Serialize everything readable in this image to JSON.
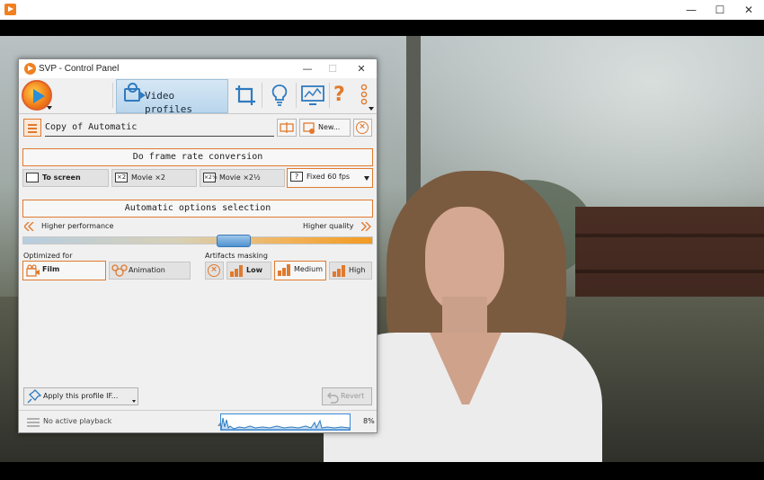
{
  "host_window": {
    "controls": {
      "minimize": "—",
      "maximize": "☐",
      "close": "✕"
    }
  },
  "panel": {
    "title": "SVP - Control Panel",
    "controls": {
      "minimize": "—",
      "maximize": "☐",
      "close": "✕"
    },
    "toolbar": {
      "active_tab": "Video profiles",
      "icons": [
        "crop-icon",
        "lightbulb-icon",
        "monitor-icon",
        "help-icon",
        "more-options-icon"
      ],
      "help_glyph": "?"
    },
    "profile": {
      "name": "Copy of Automatic",
      "new_button": "New..."
    },
    "frame_rate": {
      "header": "Do frame rate conversion",
      "options": [
        {
          "label": "To screen",
          "selected": false
        },
        {
          "label": "Movie ×2",
          "icon_text": "×2",
          "selected": false
        },
        {
          "label": "Movie ×2½",
          "icon_text": "×2½",
          "selected": false
        },
        {
          "label": "Fixed 60 fps",
          "icon_text": "?",
          "selected": true
        }
      ]
    },
    "auto_options": {
      "header": "Automatic options selection",
      "left_label": "Higher performance",
      "right_label": "Higher quality",
      "slider_position": 0.6
    },
    "optimized_for": {
      "label": "Optimized for",
      "options": [
        {
          "label": "Film",
          "selected": true
        },
        {
          "label": "Animation",
          "selected": false
        }
      ]
    },
    "artifacts_masking": {
      "label": "Artifacts masking",
      "options": [
        {
          "label": "Low",
          "selected": false
        },
        {
          "label": "Medium",
          "selected": true
        },
        {
          "label": "High",
          "selected": false
        }
      ]
    },
    "footer": {
      "apply_button": "Apply this profile IF...",
      "revert_button": "Revert"
    },
    "status": {
      "text": "No active playback",
      "cpu_percent": "8%"
    },
    "colors": {
      "accent": "#e07a2e",
      "tab_active": "#c7dff2",
      "slider_thumb": "#4f93d1"
    }
  }
}
